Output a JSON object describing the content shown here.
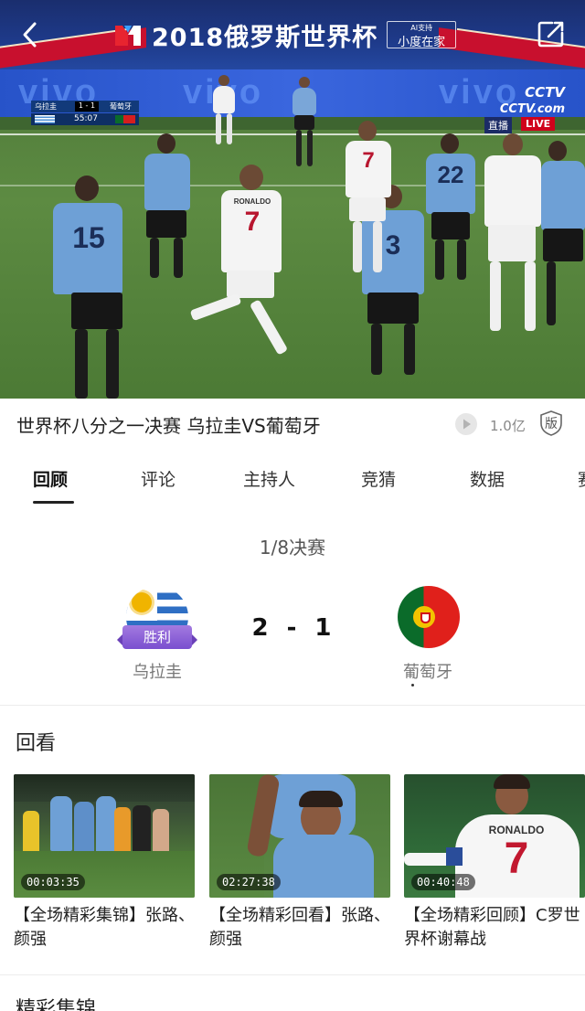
{
  "header": {
    "title": "2018俄罗斯世界杯",
    "ai_badge_top": "AI支持",
    "ai_badge_main": "小度在家",
    "colors": {
      "bg": "#1e3a8a",
      "accent_red": "#c8102e"
    },
    "icons": {
      "back": "chevron-left-icon",
      "share": "share-icon",
      "logo": "logo-icon"
    }
  },
  "video": {
    "adboard_text": "vivo",
    "scorebug": {
      "home": "乌拉圭",
      "score": "1 - 1",
      "away": "葡萄牙",
      "clock": "55:07"
    },
    "broadcaster": {
      "brand": "CCTV",
      "sub": "CCTV.com",
      "zhibo": "直播",
      "live": "LIVE"
    },
    "jerseys": [
      "15",
      "7",
      "3",
      "22",
      "7",
      "RONALDO"
    ]
  },
  "match": {
    "title": "世界杯八分之一决赛 乌拉圭VS葡萄牙",
    "views": "1.0亿",
    "copyright_label": "版"
  },
  "tabs": [
    {
      "label": "回顾",
      "active": true
    },
    {
      "label": "评论",
      "active": false
    },
    {
      "label": "主持人",
      "active": false
    },
    {
      "label": "竞猜",
      "active": false
    },
    {
      "label": "数据",
      "active": false
    },
    {
      "label": "赛",
      "active": false
    }
  ],
  "result": {
    "round": "1/8决赛",
    "home": {
      "name": "乌拉圭",
      "badge": "胜利"
    },
    "away": {
      "name": "葡萄牙"
    },
    "home_score": "2",
    "separator": "-",
    "away_score": "1"
  },
  "replay": {
    "section_title": "回看",
    "items": [
      {
        "duration": "00:03:35",
        "title": "【全场精彩集锦】张路、颜强"
      },
      {
        "duration": "02:27:38",
        "title": "【全场精彩回看】张路、颜强"
      },
      {
        "duration": "00:40:48",
        "title": "【全场精彩回顾】C罗世界杯谢幕战"
      }
    ],
    "thumb3_jersey_name": "RONALDO",
    "thumb3_jersey_number": "7"
  },
  "highlights": {
    "section_title": "精彩集锦"
  }
}
